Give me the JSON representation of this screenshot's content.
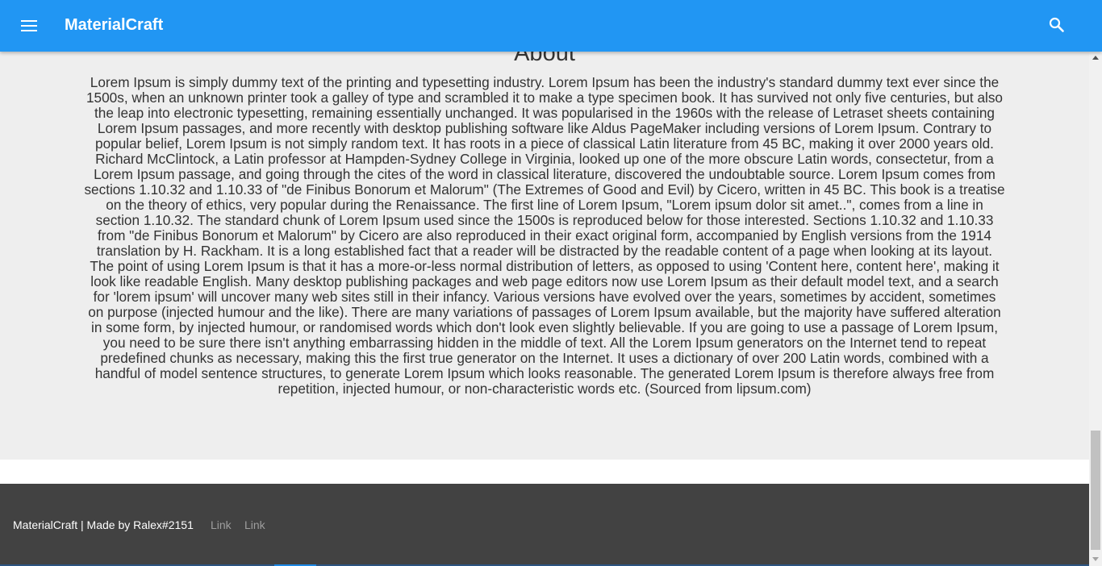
{
  "header": {
    "title": "MaterialCraft",
    "menu_icon": "menu-icon",
    "search_icon": "search-icon",
    "color": "#2196f3"
  },
  "about": {
    "title": "About",
    "text": "Lorem Ipsum is simply dummy text of the printing and typesetting industry. Lorem Ipsum has been the industry's standard dummy text ever since the 1500s, when an unknown printer took a galley of type and scrambled it to make a type specimen book. It has survived not only five centuries, but also the leap into electronic typesetting, remaining essentially unchanged. It was popularised in the 1960s with the release of Letraset sheets containing Lorem Ipsum passages, and more recently with desktop publishing software like Aldus PageMaker including versions of Lorem Ipsum. Contrary to popular belief, Lorem Ipsum is not simply random text. It has roots in a piece of classical Latin literature from 45 BC, making it over 2000 years old. Richard McClintock, a Latin professor at Hampden-Sydney College in Virginia, looked up one of the more obscure Latin words, consectetur, from a Lorem Ipsum passage, and going through the cites of the word in classical literature, discovered the undoubtable source. Lorem Ipsum comes from sections 1.10.32 and 1.10.33 of \"de Finibus Bonorum et Malorum\" (The Extremes of Good and Evil) by Cicero, written in 45 BC. This book is a treatise on the theory of ethics, very popular during the Renaissance. The first line of Lorem Ipsum, \"Lorem ipsum dolor sit amet..\", comes from a line in section 1.10.32. The standard chunk of Lorem Ipsum used since the 1500s is reproduced below for those interested. Sections 1.10.32 and 1.10.33 from \"de Finibus Bonorum et Malorum\" by Cicero are also reproduced in their exact original form, accompanied by English versions from the 1914 translation by H. Rackham. It is a long established fact that a reader will be distracted by the readable content of a page when looking at its layout. The point of using Lorem Ipsum is that it has a more-or-less normal distribution of letters, as opposed to using 'Content here, content here', making it look like readable English. Many desktop publishing packages and web page editors now use Lorem Ipsum as their default model text, and a search for 'lorem ipsum' will uncover many web sites still in their infancy. Various versions have evolved over the years, sometimes by accident, sometimes on purpose (injected humour and the like). There are many variations of passages of Lorem Ipsum available, but the majority have suffered alteration in some form, by injected humour, or randomised words which don't look even slightly believable. If you are going to use a passage of Lorem Ipsum, you need to be sure there isn't anything embarrassing hidden in the middle of text. All the Lorem Ipsum generators on the Internet tend to repeat predefined chunks as necessary, making this the first true generator on the Internet. It uses a dictionary of over 200 Latin words, combined with a handful of model sentence structures, to generate Lorem Ipsum which looks reasonable. The generated Lorem Ipsum is therefore always free from repetition, injected humour, or non-characteristic words etc. (Sourced from lipsum.com)"
  },
  "footer": {
    "text": "MaterialCraft | Made by Ralex#2151",
    "links": [
      "Link",
      "Link"
    ],
    "color": "#424242"
  }
}
